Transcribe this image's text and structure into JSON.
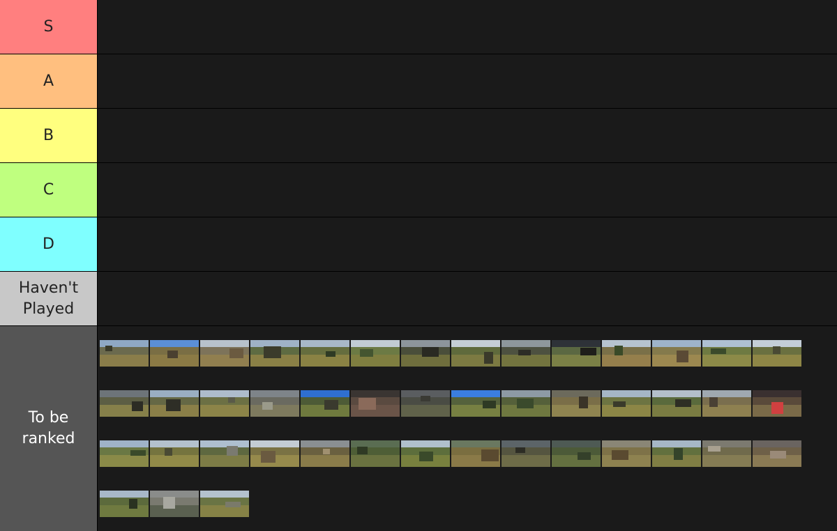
{
  "tiers": [
    {
      "id": "s",
      "label": "S",
      "color": "#ff7f7f"
    },
    {
      "id": "a",
      "label": "A",
      "color": "#ffbf7f"
    },
    {
      "id": "b",
      "label": "B",
      "color": "#ffff7f"
    },
    {
      "id": "c",
      "label": "C",
      "color": "#bfff7f"
    },
    {
      "id": "d",
      "label": "D",
      "color": "#7fffff"
    },
    {
      "id": "havent-played",
      "label": "Haven't Played",
      "color": "#c8c8c8"
    }
  ],
  "pool": {
    "label": "To be ranked",
    "color": "#555555",
    "text_color": "#ffffff",
    "items": [
      {
        "sky": "#8fa8c4",
        "mid": "#6b6a4e",
        "ground": "#8a7d4a",
        "obj": "#3a3a2a"
      },
      {
        "sky": "#5b8fd6",
        "mid": "#7a6e44",
        "ground": "#8b7a45",
        "obj": "#4a4030"
      },
      {
        "sky": "#b8c2cc",
        "mid": "#7d735a",
        "ground": "#917f4f",
        "obj": "#6b5a40"
      },
      {
        "sky": "#9fb2c6",
        "mid": "#5e6b42",
        "ground": "#8a8046",
        "obj": "#3b3b2b"
      },
      {
        "sky": "#a8b8c8",
        "mid": "#656d3e",
        "ground": "#8a8244",
        "obj": "#2f3a24"
      },
      {
        "sky": "#c2ccd4",
        "mid": "#6c7a44",
        "ground": "#7f7e40",
        "obj": "#445530"
      },
      {
        "sky": "#8d959b",
        "mid": "#4a4e3a",
        "ground": "#6f6e3d",
        "obj": "#2a2a22"
      },
      {
        "sky": "#c5ced6",
        "mid": "#5f6a3c",
        "ground": "#7c7a42",
        "obj": "#3a3a2a"
      },
      {
        "sky": "#8e979c",
        "mid": "#4d5140",
        "ground": "#73743f",
        "obj": "#2d2d26"
      },
      {
        "sky": "#2e3238",
        "mid": "#5b6842",
        "ground": "#7b8046",
        "obj": "#1e1e1a"
      },
      {
        "sky": "#b6c3cf",
        "mid": "#7a7048",
        "ground": "#957f4c",
        "obj": "#3a4a28"
      },
      {
        "sky": "#9eb3c9",
        "mid": "#847a4c",
        "ground": "#9c8850",
        "obj": "#5a4a35"
      },
      {
        "sky": "#aec0d2",
        "mid": "#6e7a42",
        "ground": "#8c8a48",
        "obj": "#3a4a2a"
      },
      {
        "sky": "#c4ced8",
        "mid": "#6a7040",
        "ground": "#8e8646",
        "obj": "#4a4a34"
      },
      {
        "sky": "#6d7479",
        "mid": "#5c5e44",
        "ground": "#86804a",
        "obj": "#2c2c24"
      },
      {
        "sky": "#9aaec2",
        "mid": "#656845",
        "ground": "#8a7f48",
        "obj": "#2e2e26"
      },
      {
        "sky": "#aebccb",
        "mid": "#6c7044",
        "ground": "#8c8448",
        "obj": "#5a5a48"
      },
      {
        "sky": "#7e8489",
        "mid": "#6a6a60",
        "ground": "#7e7a5e",
        "obj": "#9a9a8a"
      },
      {
        "sky": "#2f6fd0",
        "mid": "#4d5b36",
        "ground": "#6f7a3e",
        "obj": "#3a3a2e"
      },
      {
        "sky": "#3a3532",
        "mid": "#5a4a40",
        "ground": "#6a5448",
        "obj": "#8a6a5a"
      },
      {
        "sky": "#5a5d60",
        "mid": "#4a4c44",
        "ground": "#60624a",
        "obj": "#3a3a34"
      },
      {
        "sky": "#3b7ee0",
        "mid": "#55623c",
        "ground": "#778042",
        "obj": "#2e3a24"
      },
      {
        "sky": "#8d9aa4",
        "mid": "#55603a",
        "ground": "#6f7840",
        "obj": "#3a4a2c"
      },
      {
        "sky": "#6c6a5c",
        "mid": "#7a6e48",
        "ground": "#8f8450",
        "obj": "#3a3428"
      },
      {
        "sky": "#a5b6c6",
        "mid": "#6d7442",
        "ground": "#8c8646",
        "obj": "#3a3a2a"
      },
      {
        "sky": "#b3bfca",
        "mid": "#5a6a3c",
        "ground": "#7a7c42",
        "obj": "#2e2e24"
      },
      {
        "sky": "#9fa8b0",
        "mid": "#7a6e4e",
        "ground": "#8e8050",
        "obj": "#4a4034"
      },
      {
        "sky": "#3a3030",
        "mid": "#5a4a3a",
        "ground": "#7a6a48",
        "obj": "#d04040"
      },
      {
        "sky": "#9fb3c8",
        "mid": "#6a7844",
        "ground": "#8a8a48",
        "obj": "#3a4a2a"
      },
      {
        "sky": "#b4c1cd",
        "mid": "#75743f",
        "ground": "#918a48",
        "obj": "#4a4a34"
      },
      {
        "sky": "#aebfcf",
        "mid": "#5e6840",
        "ground": "#7d7c46",
        "obj": "#7a7a70"
      },
      {
        "sky": "#c3ccd4",
        "mid": "#7a7244",
        "ground": "#968a4c",
        "obj": "#6a5a40"
      },
      {
        "sky": "#8a8f92",
        "mid": "#6a6040",
        "ground": "#8a7c4a",
        "obj": "#a09070"
      },
      {
        "sky": "#5a6d52",
        "mid": "#4e5e36",
        "ground": "#6a7240",
        "obj": "#2f3a24"
      },
      {
        "sky": "#b0c0cc",
        "mid": "#5d6e3c",
        "ground": "#78803e",
        "obj": "#3a4a2a"
      },
      {
        "sky": "#6a7860",
        "mid": "#7a6e40",
        "ground": "#8a7a48",
        "obj": "#5a4a30"
      },
      {
        "sky": "#5c6468",
        "mid": "#555540",
        "ground": "#6e6c48",
        "obj": "#2c2c24"
      },
      {
        "sky": "#4e5a54",
        "mid": "#4c5a38",
        "ground": "#647040",
        "obj": "#34402a"
      },
      {
        "sky": "#8a8676",
        "mid": "#7e7248",
        "ground": "#8e8250",
        "obj": "#5a4a30"
      },
      {
        "sky": "#a6b7c6",
        "mid": "#62703e",
        "ground": "#807e44",
        "obj": "#34442a"
      },
      {
        "sky": "#7c7a70",
        "mid": "#706a4c",
        "ground": "#857c54",
        "obj": "#a8a090"
      },
      {
        "sky": "#6a6460",
        "mid": "#6e6048",
        "ground": "#8a7a54",
        "obj": "#9a8a78"
      },
      {
        "sky": "#a8b8c8",
        "mid": "#5c6a3c",
        "ground": "#6f7a40",
        "obj": "#2a3220"
      },
      {
        "sky": "#8a8c8a",
        "mid": "#7a7a70",
        "ground": "#5a6050",
        "obj": "#a8a8a0"
      },
      {
        "sky": "#b4c2ce",
        "mid": "#6a7444",
        "ground": "#868246",
        "obj": "#7a7a6a"
      }
    ]
  }
}
